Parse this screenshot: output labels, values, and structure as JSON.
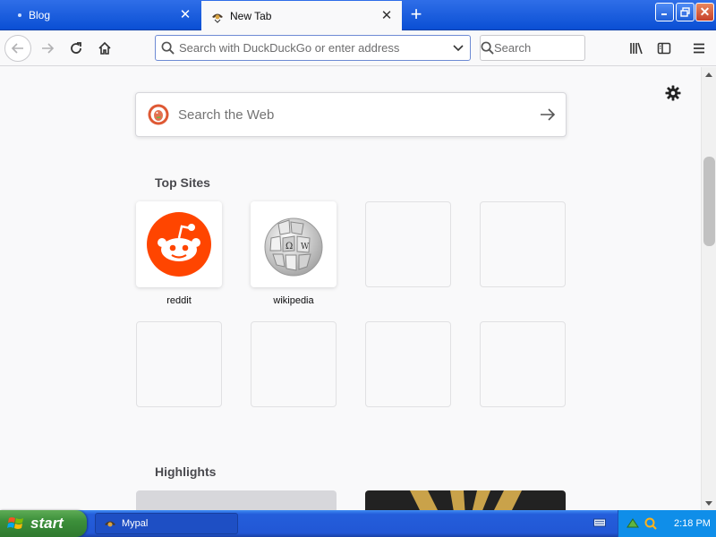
{
  "tabs": [
    {
      "title": "Blog",
      "active": false
    },
    {
      "title": "New Tab",
      "active": true
    }
  ],
  "window_controls": {
    "minimize": "minimize",
    "maximize": "maximize",
    "close": "close"
  },
  "nav": {
    "back": "back-icon",
    "forward": "forward-icon",
    "reload": "reload-icon",
    "home": "home-icon"
  },
  "urlbar": {
    "placeholder": "Search with DuckDuckGo or enter address",
    "value": ""
  },
  "searchbar": {
    "placeholder": "Search"
  },
  "toolbar_right": [
    "library-icon",
    "sidebar-icon",
    "menu-icon"
  ],
  "newtab": {
    "web_search_placeholder": "Search the Web",
    "top_sites_title": "Top Sites",
    "top_sites": [
      {
        "label": "reddit",
        "icon": "reddit-logo"
      },
      {
        "label": "wikipedia",
        "icon": "wikipedia-logo"
      },
      {
        "label": "",
        "icon": ""
      },
      {
        "label": "",
        "icon": ""
      },
      {
        "label": "",
        "icon": ""
      },
      {
        "label": "",
        "icon": ""
      },
      {
        "label": "",
        "icon": ""
      },
      {
        "label": "",
        "icon": ""
      }
    ],
    "highlights_title": "Highlights"
  },
  "taskbar": {
    "start_label": "start",
    "window_button": "Mypal",
    "clock": "2:18 PM"
  },
  "colors": {
    "titlebar": "#0a4fd4",
    "reddit": "#ff4500",
    "start_green": "#3c8f3a",
    "taskbar_blue": "#2257d5"
  }
}
